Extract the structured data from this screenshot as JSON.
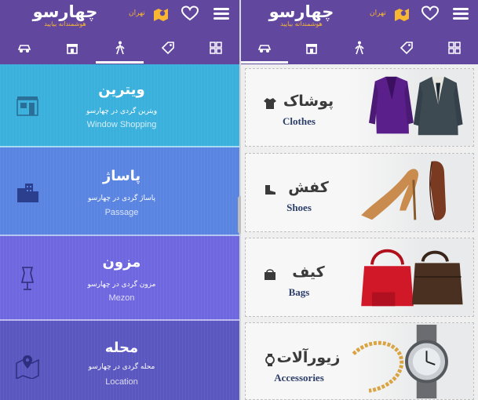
{
  "app": {
    "logo_text": "چهارسو",
    "tagline": "هوشمندانه بیایید",
    "city": "تهران"
  },
  "tabs": [
    "car-tab",
    "shop-tab",
    "walking-tab",
    "tag-tab",
    "grid-tab"
  ],
  "colors": {
    "header": "#62479e",
    "accent": "#f7b732",
    "window_shopping": "#3ab0dd",
    "passage": "#5a84e2",
    "mezon": "#6e67df",
    "location": "#5a57c0",
    "card_title": "#2c3e6a"
  },
  "left_panels": [
    {
      "title": "ویترین",
      "desc": "ویترین گردی در چهارسو",
      "en": "Window Shopping",
      "icon": "storefront-icon"
    },
    {
      "title": "پاساژ",
      "desc": "پاساژ گردی در چهارسو",
      "en": "Passage",
      "icon": "buildings-icon"
    },
    {
      "title": "مزون",
      "desc": "مزون گردی در چهارسو",
      "en": "Mezon",
      "icon": "mannequin-icon"
    },
    {
      "title": "محله",
      "desc": "محله گردی در چهارسو",
      "en": "Location",
      "icon": "map-pin-icon"
    }
  ],
  "categories": [
    {
      "fa": "پوشاک",
      "en": "Clothes",
      "icon": "shirt-icon",
      "art": "jackets-image"
    },
    {
      "fa": "کفش",
      "en": "Shoes",
      "icon": "boot-icon",
      "art": "shoes-image"
    },
    {
      "fa": "کیف",
      "en": "Bags",
      "icon": "bag-icon",
      "art": "bags-image"
    },
    {
      "fa": "زیورآلات",
      "en": "Accessories",
      "icon": "watch-icon",
      "art": "watch-image"
    }
  ]
}
